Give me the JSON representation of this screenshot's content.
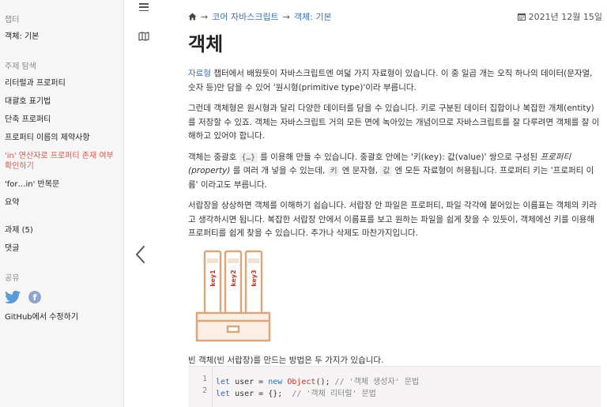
{
  "sidebar": {
    "chapter_heading": "챕터",
    "chapter_item": "객체: 기본",
    "topics_heading": "주제 탐색",
    "topics": [
      {
        "label": "리터럴과 프로퍼티",
        "active": false
      },
      {
        "label": "대괄호 표기법",
        "active": false
      },
      {
        "label": "단축 프로퍼티",
        "active": false
      },
      {
        "label": "프로퍼티 이름의 제약사항",
        "active": false
      },
      {
        "label": "'in' 연산자로 프로퍼티 존재 여부 확인하기",
        "active": true
      },
      {
        "label": "'for…in' 반복문",
        "active": false
      },
      {
        "label": "요약",
        "active": false
      }
    ],
    "tasks": "과제 (5)",
    "comments": "댓글",
    "share_heading": "공유",
    "share_icons": [
      "twitter-icon",
      "facebook-icon"
    ],
    "edit_github": "GitHub에서 수정하기"
  },
  "breadcrumb": {
    "home_icon": "home-icon",
    "sep": "→",
    "items": [
      "코어 자바스크립트",
      "객체: 기본"
    ]
  },
  "date": "2021년 12월 15일",
  "page_title": "객체",
  "paragraphs": {
    "p1_link": "자료형",
    "p1_rest": " 챕터에서 배웠듯이 자바스크립트엔 여덟 가지 자료형이 있습니다. 이 중 일곱 개는 오직 하나의 데이터(문자열, 숫자 등)만 담을 수 있어 '원시형(primitive type)'이라 부릅니다.",
    "p2": "그런데 객체형은 원시형과 달리 다양한 데이터를 담을 수 있습니다. 키로 구분된 데이터 집합이나 복잡한 개체(entity)를 저장할 수 있죠. 객체는 자바스크립트 거의 모든 면에 녹아있는 개념이므로 자바스크립트를 잘 다루려면 객체를 잘 이해하고 있어야 합니다.",
    "p3_a": "객체는 중괄호 ",
    "p3_code1": "{…}",
    "p3_b": " 를 이용해 만들 수 있습니다. 중괄호 안에는 '키(key): 값(value)' 쌍으로 구성된 ",
    "p3_em": "프로퍼티(property)",
    "p3_c": " 를 여러 개 넣을 수 있는데, ",
    "p3_code2": "키",
    "p3_d": " 엔 문자형, ",
    "p3_code3": "값",
    "p3_e": " 엔 모든 자료형이 허용됩니다. 프로퍼티 키는 '프로퍼티 이름' 이라고도 부릅니다.",
    "p4": "서랍장을 상상하면 객체를 이해하기 쉽습니다. 서랍장 안 파일은 프로퍼티, 파일 각각에 붙어있는 이름표는 객체의 키라고 생각하시면 됩니다. 복잡한 서랍장 안에서 이름표를 보고 원하는 파일을 쉽게 찾을 수 있듯이, 객체에선 키를 이용해 프로퍼티를 쉽게 찾을 수 있습니다. 추가나 삭제도 마찬가지입니다.",
    "p5": "빈 객체(빈 서랍장)를 만드는 방법은 두 가지가 있습니다."
  },
  "illustration": {
    "labels": [
      "key1",
      "key2",
      "key3"
    ],
    "color": "#e0b48c"
  },
  "code": {
    "lines": [
      {
        "num": "1",
        "kw": "let",
        "a": " user = ",
        "kw2": "new",
        "sp": " ",
        "fn": "Object",
        "b": "(); ",
        "cm": "// '객체 생성자' 문법"
      },
      {
        "num": "2",
        "kw": "let",
        "a": " user = {};  ",
        "kw2": "",
        "sp": "",
        "fn": "",
        "b": "",
        "cm": "// '객체 리터럴' 문법"
      }
    ]
  },
  "colors": {
    "link": "#3c73b5",
    "active": "#d05a4e",
    "accent": "#e0b48c"
  }
}
